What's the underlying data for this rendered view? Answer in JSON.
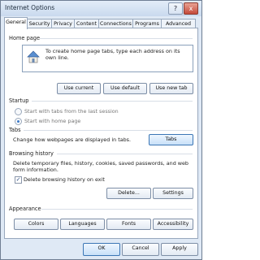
{
  "window": {
    "title": "Internet Options",
    "help_glyph": "?",
    "close_glyph": "x"
  },
  "tabs": [
    {
      "label": "General"
    },
    {
      "label": "Security"
    },
    {
      "label": "Privacy"
    },
    {
      "label": "Content"
    },
    {
      "label": "Connections"
    },
    {
      "label": "Programs"
    },
    {
      "label": "Advanced"
    }
  ],
  "home_page": {
    "section_label": "Home page",
    "instructions": "To create home page tabs, type each address on its own line.",
    "buttons": {
      "current": "Use current",
      "default": "Use default",
      "new_tab": "Use new tab"
    }
  },
  "startup": {
    "section_label": "Startup",
    "options": [
      {
        "label": "Start with tabs from the last session",
        "selected": false
      },
      {
        "label": "Start with home page",
        "selected": true
      }
    ]
  },
  "tabs_section": {
    "section_label": "Tabs",
    "description": "Change how webpages are displayed in tabs.",
    "button": "Tabs"
  },
  "browsing_history": {
    "section_label": "Browsing history",
    "description_line1": "Delete temporary files, history, cookies, saved passwords, and web",
    "description_line2": "form information.",
    "checkbox_label": "Delete browsing history on exit",
    "checkbox_checked": true,
    "buttons": {
      "delete": "Delete...",
      "settings": "Settings"
    }
  },
  "appearance": {
    "section_label": "Appearance",
    "buttons": {
      "colors": "Colors",
      "languages": "Languages",
      "fonts": "Fonts",
      "accessibility": "Accessibility"
    }
  },
  "footer": {
    "ok": "OK",
    "cancel": "Cancel",
    "apply": "Apply"
  },
  "icons": {
    "home": "house-icon",
    "check": "check-icon"
  },
  "colors": {
    "panel_border": "#98a8bd",
    "accent": "#3a79c7"
  }
}
